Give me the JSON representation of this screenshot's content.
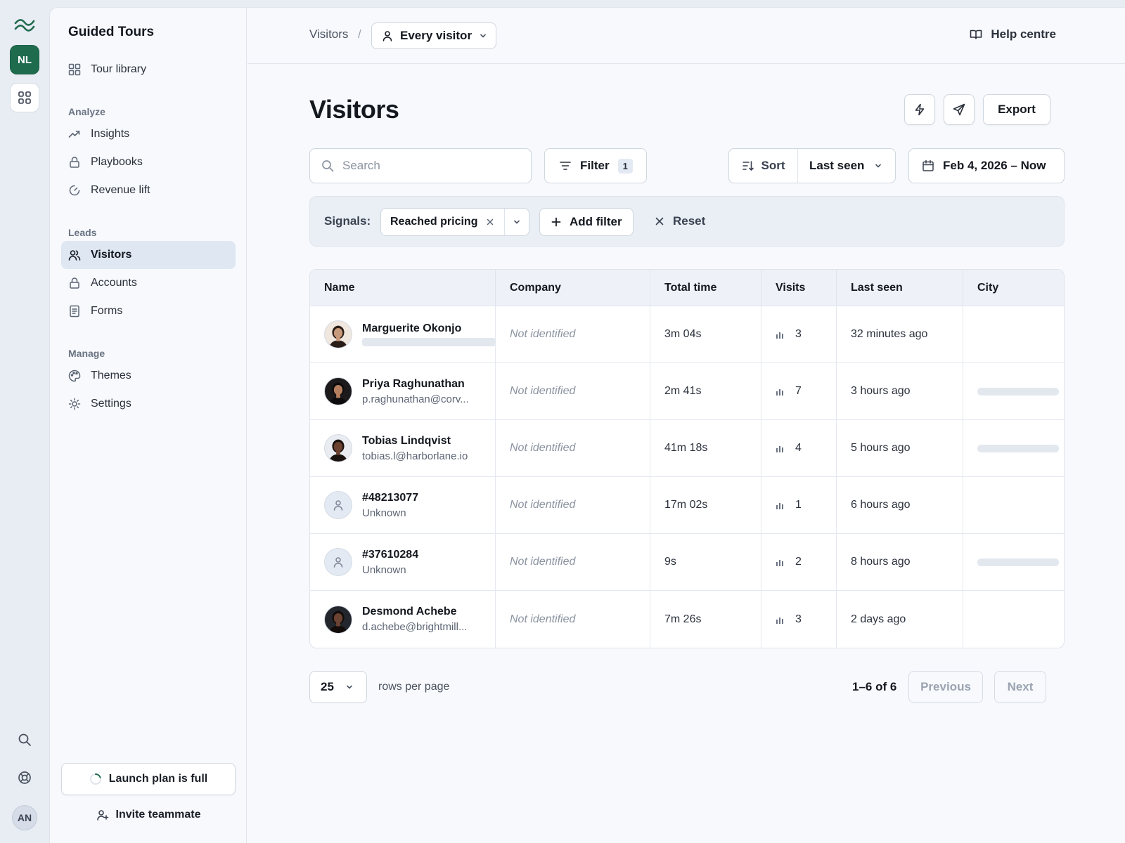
{
  "rail": {
    "workspace_initials": "NL",
    "user_initials": "AN"
  },
  "sidebar": {
    "product_title": "Guided Tours",
    "top_items": [
      {
        "label": "Tour library",
        "icon": "grid-icon"
      }
    ],
    "sections": [
      {
        "label": "Analyze",
        "items": [
          {
            "label": "Insights",
            "icon": "trend-icon"
          },
          {
            "label": "Playbooks",
            "icon": "lock-icon"
          },
          {
            "label": "Revenue lift",
            "icon": "gauge-icon"
          }
        ]
      },
      {
        "label": "Leads",
        "items": [
          {
            "label": "Visitors",
            "icon": "users-icon",
            "active": true
          },
          {
            "label": "Accounts",
            "icon": "lock-icon"
          },
          {
            "label": "Forms",
            "icon": "document-icon"
          }
        ]
      },
      {
        "label": "Manage",
        "items": [
          {
            "label": "Themes",
            "icon": "palette-icon"
          },
          {
            "label": "Settings",
            "icon": "sun-gear-icon"
          }
        ]
      }
    ],
    "plan_label": "Launch plan is full",
    "invite_label": "Invite teammate"
  },
  "topbar": {
    "breadcrumb": "Visitors",
    "separator": "/",
    "segment_label": "Every visitor",
    "help_label": "Help centre"
  },
  "page": {
    "title": "Visitors",
    "export_label": "Export"
  },
  "toolbar": {
    "search_placeholder": "Search",
    "filter_label": "Filter",
    "filter_count": "1",
    "sort_label": "Sort",
    "sort_value": "Last seen",
    "date_range": "Feb 4, 2026 – Now"
  },
  "signals": {
    "label": "Signals:",
    "chip_label": "Reached pricing",
    "add_filter_label": "Add filter",
    "reset_label": "Reset"
  },
  "table": {
    "columns": [
      "Name",
      "Company",
      "Total time",
      "Visits",
      "Last seen",
      "City"
    ],
    "rows": [
      {
        "name": "Marguerite Okonjo",
        "sub": "",
        "company": "Not identified",
        "total_time": "3m 04s",
        "visits": "3",
        "last_seen": "32 minutes ago",
        "city_loading": false,
        "avatar": "photo",
        "avatar_bg": "#f0e7df",
        "avatar_skin": "#c89a7c",
        "avatar_hair": "#2a1d17"
      },
      {
        "name": "Priya Raghunathan",
        "sub": "p.raghunathan@corv...",
        "company": "Not identified",
        "total_time": "2m 41s",
        "visits": "7",
        "last_seen": "3 hours ago",
        "city_loading": true,
        "avatar": "photo",
        "avatar_bg": "#1c1a1b",
        "avatar_skin": "#b47f5f",
        "avatar_hair": "#0d0b0b"
      },
      {
        "name": "Tobias Lindqvist",
        "sub": "tobias.l@harborlane.io",
        "company": "Not identified",
        "total_time": "41m 18s",
        "visits": "4",
        "last_seen": "5 hours ago",
        "city_loading": true,
        "avatar": "photo",
        "avatar_bg": "#e9edf2",
        "avatar_skin": "#6b4330",
        "avatar_hair": "#1a120e"
      },
      {
        "name": "#48213077",
        "sub": "Unknown",
        "company": "Not identified",
        "total_time": "17m 02s",
        "visits": "1",
        "last_seen": "6 hours ago",
        "city_loading": false,
        "avatar": "unknown"
      },
      {
        "name": "#37610284",
        "sub": "Unknown",
        "company": "Not identified",
        "total_time": "9s",
        "visits": "2",
        "last_seen": "8 hours ago",
        "city_loading": true,
        "avatar": "unknown"
      },
      {
        "name": "Desmond Achebe",
        "sub": "d.achebe@brightmill...",
        "company": "Not identified",
        "total_time": "7m 26s",
        "visits": "3",
        "last_seen": "2 days ago",
        "city_loading": false,
        "avatar": "photo",
        "avatar_bg": "#23262c",
        "avatar_skin": "#6a4332",
        "avatar_hair": "#120c0a"
      }
    ]
  },
  "pagination": {
    "page_size": "25",
    "rows_label": "rows per page",
    "range": "1–6 of 6",
    "previous_label": "Previous",
    "next_label": "Next"
  },
  "colors": {
    "brand": "#1f6b4d",
    "active_nav": "#dfe7f3",
    "border": "#cfd6df"
  }
}
